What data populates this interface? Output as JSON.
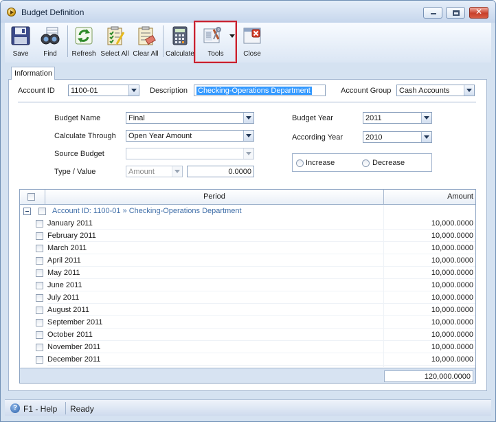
{
  "window": {
    "title": "Budget Definition"
  },
  "toolbar": {
    "save": "Save",
    "find": "Find",
    "refresh": "Refresh",
    "select_all": "Select All",
    "clear_all": "Clear All",
    "calculate": "Calculate",
    "tools": "Tools",
    "close": "Close"
  },
  "tabs": {
    "information": "Information"
  },
  "header": {
    "account_id_label": "Account ID",
    "account_id_value": "1100-01",
    "description_label": "Description",
    "description_value": "Checking-Operations Department",
    "account_group_label": "Account Group",
    "account_group_value": "Cash Accounts"
  },
  "form": {
    "budget_name_label": "Budget Name",
    "budget_name_value": "Final",
    "calculate_through_label": "Calculate Through",
    "calculate_through_value": "Open Year Amount",
    "source_budget_label": "Source Budget",
    "source_budget_value": "",
    "type_value_label": "Type / Value",
    "type_value": "Amount",
    "numeric_value": "0.0000",
    "budget_year_label": "Budget Year",
    "budget_year_value": "2011",
    "according_year_label": "According Year",
    "according_year_value": "2010",
    "increase_label": "Increase",
    "decrease_label": "Decrease"
  },
  "grid": {
    "col_period": "Period",
    "col_amount": "Amount",
    "group_label": "Account ID: 1100-01 » Checking-Operations Department",
    "rows": [
      {
        "period": "January 2011",
        "amount": "10,000.0000"
      },
      {
        "period": "February 2011",
        "amount": "10,000.0000"
      },
      {
        "period": "March 2011",
        "amount": "10,000.0000"
      },
      {
        "period": "April 2011",
        "amount": "10,000.0000"
      },
      {
        "period": "May 2011",
        "amount": "10,000.0000"
      },
      {
        "period": "June 2011",
        "amount": "10,000.0000"
      },
      {
        "period": "July 2011",
        "amount": "10,000.0000"
      },
      {
        "period": "August 2011",
        "amount": "10,000.0000"
      },
      {
        "period": "September 2011",
        "amount": "10,000.0000"
      },
      {
        "period": "October 2011",
        "amount": "10,000.0000"
      },
      {
        "period": "November 2011",
        "amount": "10,000.0000"
      },
      {
        "period": "December 2011",
        "amount": "10,000.0000"
      }
    ],
    "total": "120,000.0000"
  },
  "statusbar": {
    "help": "F1 - Help",
    "status": "Ready"
  }
}
